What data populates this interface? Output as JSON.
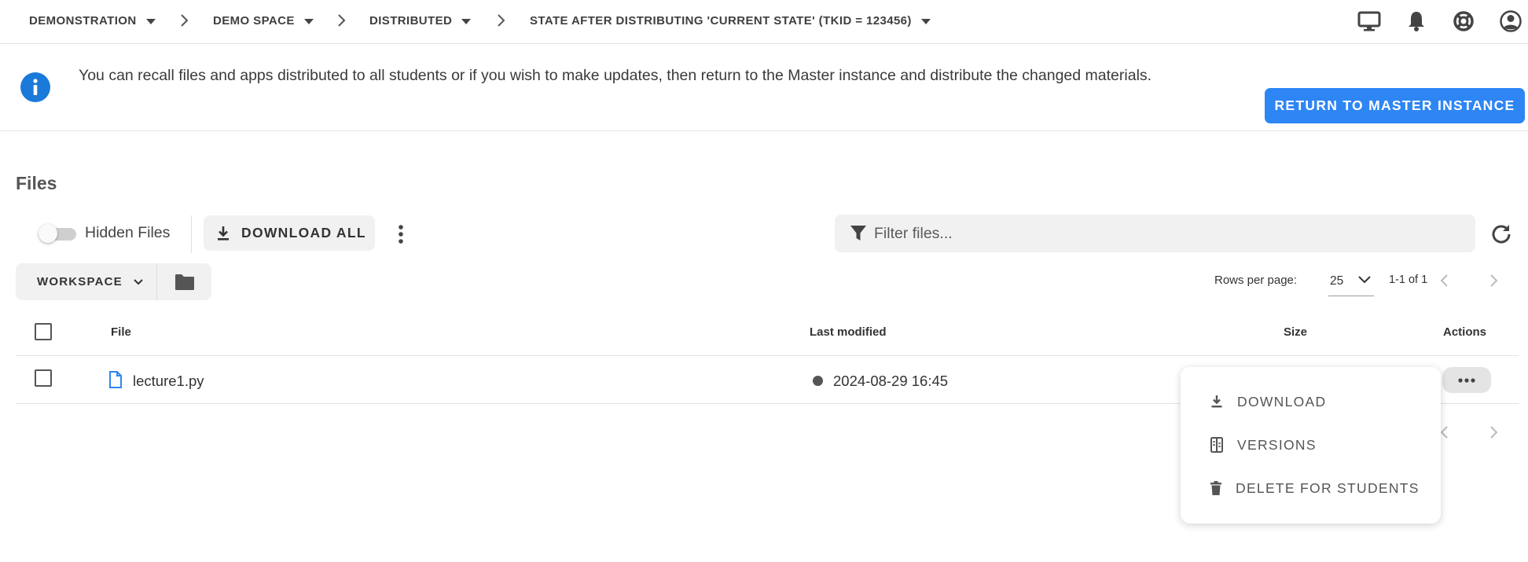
{
  "breadcrumbs": [
    {
      "label": "DEMONSTRATION"
    },
    {
      "label": "DEMO SPACE"
    },
    {
      "label": "DISTRIBUTED"
    },
    {
      "label": "STATE AFTER DISTRIBUTING 'CURRENT STATE' (TKID = 123456)"
    }
  ],
  "top_icons": [
    "monitor-icon",
    "bell-icon",
    "lifebuoy-icon",
    "account-circle-icon"
  ],
  "banner": {
    "text": "You can recall files and apps distributed to all students or if you wish to make updates, then return to the Master instance and distribute the changed materials.",
    "button": "RETURN TO MASTER INSTANCE",
    "accent": "#2e86f5",
    "info_color": "#1a7ad9"
  },
  "files": {
    "title": "Files",
    "hidden_toggle_label": "Hidden Files",
    "hidden_toggle_on": false,
    "download_all": "DOWNLOAD ALL",
    "filter_placeholder": "Filter files...",
    "workspace": "WORKSPACE",
    "rows_per_page_label": "Rows per page:",
    "rows_per_page": "25",
    "range": "1-1 of 1"
  },
  "table": {
    "headers": {
      "file": "File",
      "last_modified": "Last modified",
      "size": "Size",
      "actions": "Actions"
    },
    "rows": [
      {
        "name": "lecture1.py",
        "modified": "2024-08-29 16:45",
        "size": ""
      }
    ]
  },
  "menu": {
    "items": [
      {
        "label": "DOWNLOAD",
        "icon": "download-icon"
      },
      {
        "label": "VERSIONS",
        "icon": "versions-icon"
      },
      {
        "label": "DELETE FOR STUDENTS",
        "icon": "trash-icon"
      }
    ]
  }
}
